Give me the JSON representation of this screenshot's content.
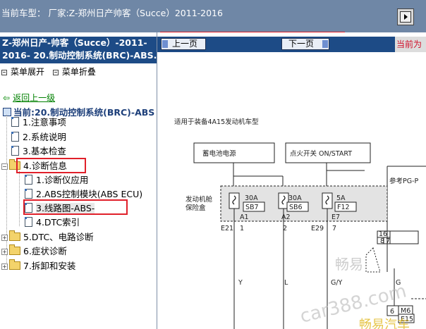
{
  "topbar": {
    "title": "当前车型：  厂家:Z-郑州日产帅客（Succe）2011-2016",
    "corner_button_icon": "window-nav-icon"
  },
  "sidebar": {
    "header_line1": "Z-郑州日产-帅客（Succe）-2011-",
    "header_line2": "2016- 20.制动控制系统(BRC)-ABS.",
    "expand_label": "菜单展开",
    "collapse_label": "菜单折叠",
    "back_label": "返回上一级",
    "current_label": "当前:20.制动控制系统(BRC)-ABS",
    "items": [
      {
        "label": "1.注意事项",
        "type": "doc"
      },
      {
        "label": "2.系统说明",
        "type": "doc"
      },
      {
        "label": "3.基本检查",
        "type": "doc"
      },
      {
        "label": "4.诊断信息",
        "type": "folder-open"
      },
      {
        "label": "1.诊断仪应用",
        "type": "doc"
      },
      {
        "label": "2.ABS控制模块(ABS ECU)",
        "type": "doc"
      },
      {
        "label": "3.线路图-ABS-",
        "type": "doc",
        "selected": true
      },
      {
        "label": "4.DTC索引",
        "type": "doc"
      },
      {
        "label": "5.DTC、电路诊断",
        "type": "folder"
      },
      {
        "label": "6.症状诊断",
        "type": "folder"
      },
      {
        "label": "7.拆卸和安装",
        "type": "folder"
      }
    ]
  },
  "main": {
    "prev_label": "上一页",
    "next_label": "下一页",
    "current_label": "当前为"
  },
  "diagram": {
    "applies_to": "适用于装备4A15发动机车型",
    "battery": "蓄电池电源",
    "ignition": "点火开关 ON/START",
    "ref": "参考PG-P",
    "fusebox_line1": "发动机舱",
    "fusebox_line2": "保险盒",
    "fuses": [
      {
        "amp": "30A",
        "code": "SB7",
        "pin": "A1"
      },
      {
        "amp": "30A",
        "code": "SB6",
        "pin": "A2"
      },
      {
        "amp": "5A",
        "code": "F12",
        "pin": "E7"
      }
    ],
    "connectors": [
      "E21",
      "E29"
    ],
    "pin_extra": "2",
    "wires": [
      "Y",
      "L",
      "G/Y",
      "G"
    ],
    "conn_pins": [
      "16",
      "8",
      "7",
      "6"
    ],
    "m6": "M6",
    "e15": "E15",
    "watermark_1": "畅易",
    "watermark_2": "car388.com",
    "watermark_3": "畅易汽车"
  },
  "colors": {
    "topbar_bg": "#6f87a6",
    "header_bg": "#1d4b86",
    "highlight": "#e0202a"
  }
}
